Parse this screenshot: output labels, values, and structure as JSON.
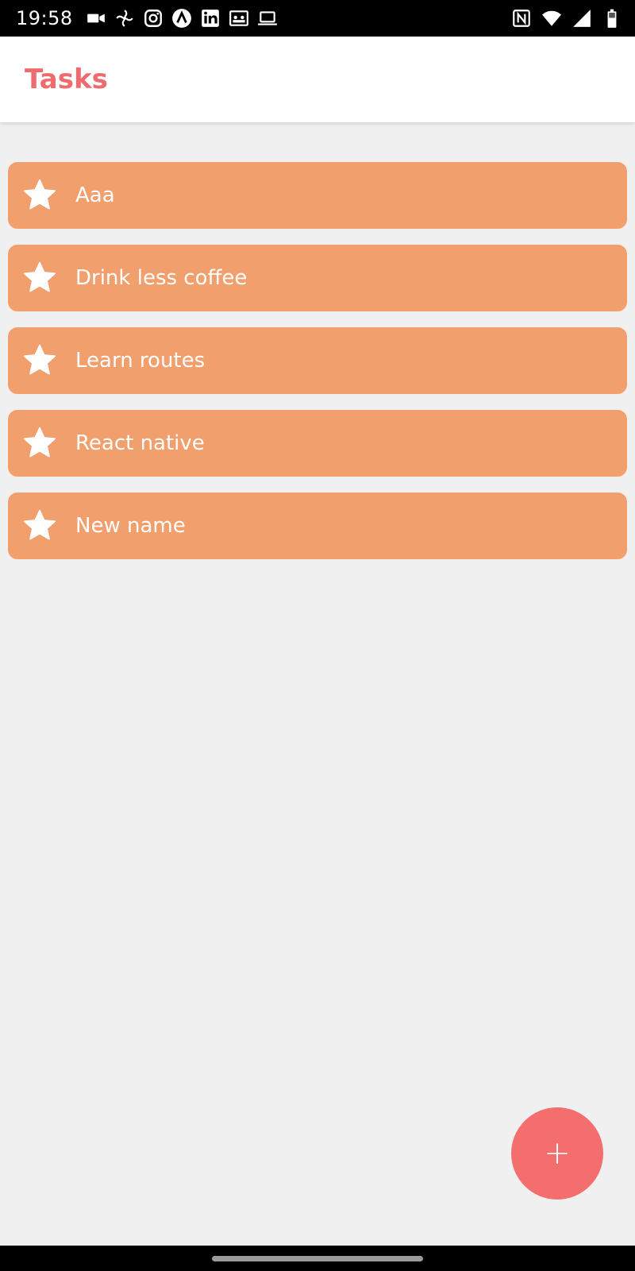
{
  "status_bar": {
    "time": "19:58",
    "left_icons": [
      "video-icon",
      "fan-icon",
      "instagram-icon",
      "arc-icon",
      "linkedin-icon",
      "contacts-icon",
      "laptop-icon"
    ],
    "right_icons": [
      "nfc-icon",
      "wifi-icon",
      "signal-icon",
      "battery-icon"
    ]
  },
  "header": {
    "title": "Tasks"
  },
  "tasks": [
    {
      "label": "Aaa",
      "icon": "star-icon"
    },
    {
      "label": "Drink less coffee",
      "icon": "star-icon"
    },
    {
      "label": "Learn routes",
      "icon": "star-icon"
    },
    {
      "label": "React native",
      "icon": "star-icon"
    },
    {
      "label": "New name",
      "icon": "star-icon"
    }
  ],
  "fab": {
    "label": "+"
  },
  "colors": {
    "accent": "#ee6b6e",
    "task_card": "#f19f6c",
    "fab": "#f46e6e",
    "background": "#f0f0f0"
  }
}
